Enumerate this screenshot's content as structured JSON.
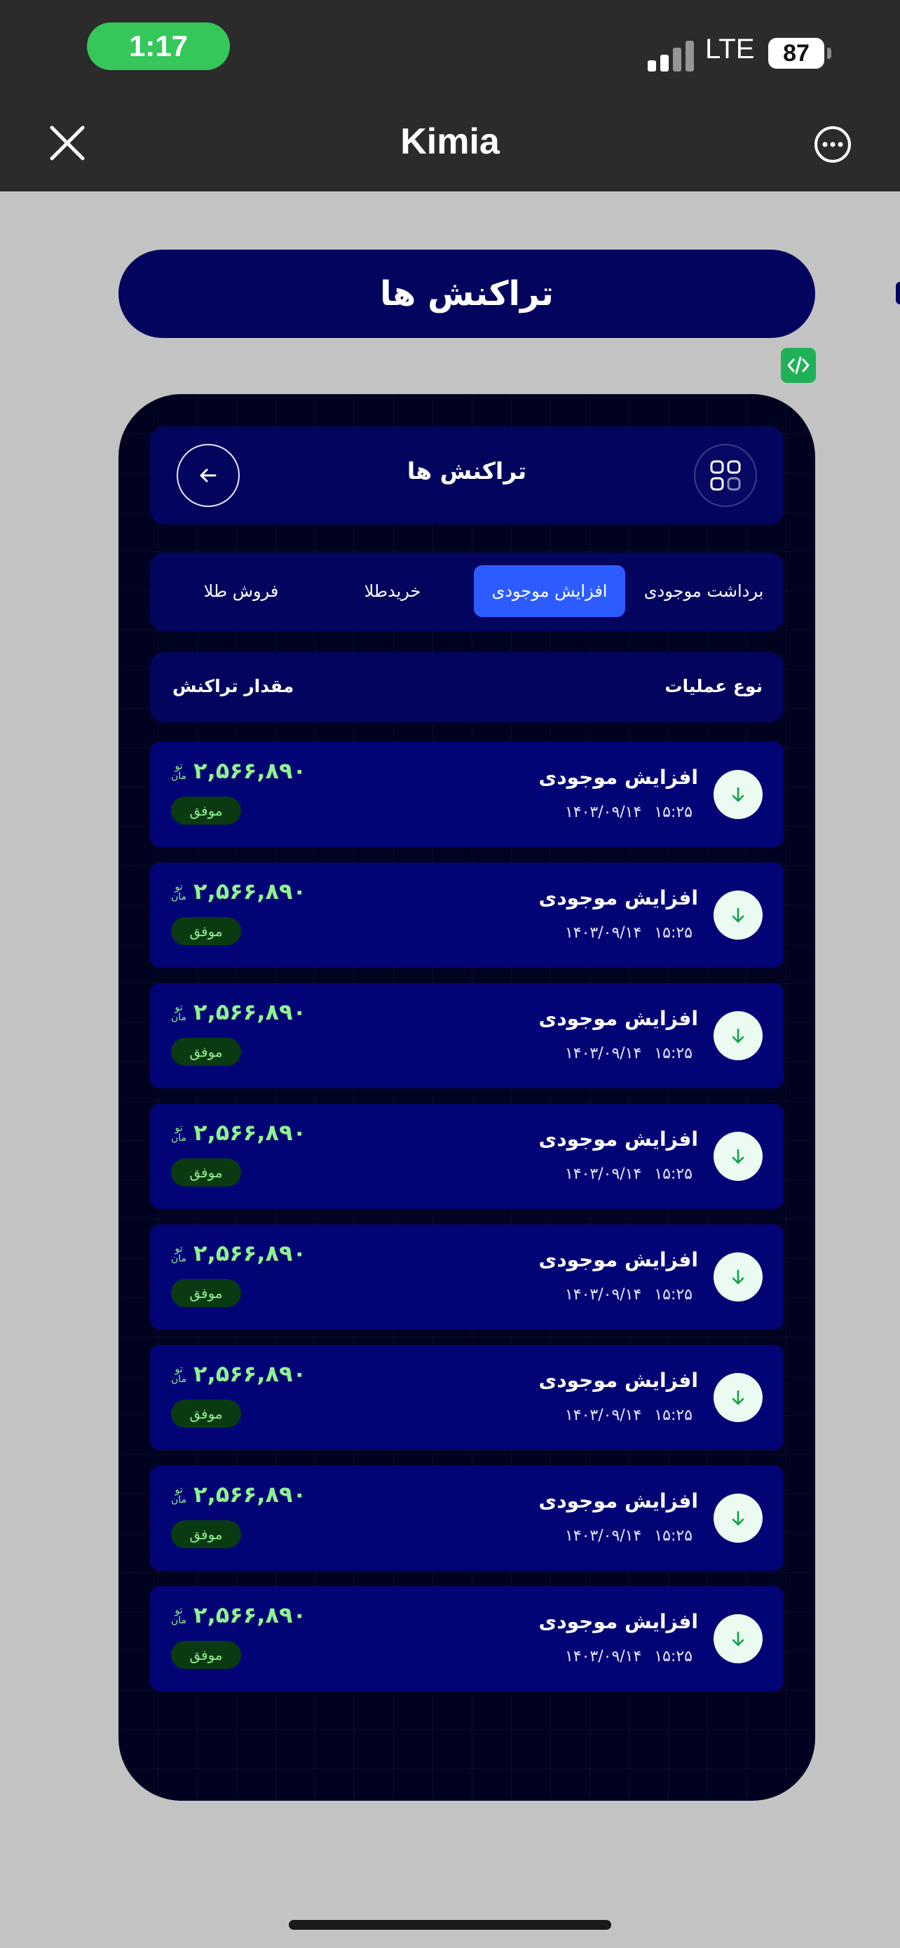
{
  "status_bar": {
    "time": "1:17",
    "network": "LTE",
    "battery": "87"
  },
  "app_bar": {
    "title": "Kimia",
    "close_icon": "close-icon",
    "more_icon": "more-horizontal-icon"
  },
  "page_header": {
    "title": "تراکنش ها"
  },
  "phone": {
    "title": "تراکنش ها",
    "back_icon": "arrow-left-icon",
    "menu_icon": "grid-apps-icon",
    "tabs": [
      {
        "label": "برداشت موجودی",
        "active": false
      },
      {
        "label": "افزایش موجودی",
        "active": true
      },
      {
        "label": "خریدطلا",
        "active": false
      },
      {
        "label": "فروش طلا",
        "active": false
      }
    ],
    "columns": {
      "type": "نوع عملیات",
      "amount": "مقدار تراکنش"
    },
    "transactions": [
      {
        "title": "افزایش موجودی",
        "time": "۱۵:۲۵",
        "date": "۱۴۰۳/۰۹/۱۴",
        "amount": "۲,۵۶۶,۸۹۰",
        "currency_top": "تو",
        "currency_bottom": "مان",
        "status": "موفق",
        "icon": "arrow-down-icon"
      },
      {
        "title": "افزایش موجودی",
        "time": "۱۵:۲۵",
        "date": "۱۴۰۳/۰۹/۱۴",
        "amount": "۲,۵۶۶,۸۹۰",
        "currency_top": "تو",
        "currency_bottom": "مان",
        "status": "موفق",
        "icon": "arrow-down-icon"
      },
      {
        "title": "افزایش موجودی",
        "time": "۱۵:۲۵",
        "date": "۱۴۰۳/۰۹/۱۴",
        "amount": "۲,۵۶۶,۸۹۰",
        "currency_top": "تو",
        "currency_bottom": "مان",
        "status": "موفق",
        "icon": "arrow-down-icon"
      },
      {
        "title": "افزایش موجودی",
        "time": "۱۵:۲۵",
        "date": "۱۴۰۳/۰۹/۱۴",
        "amount": "۲,۵۶۶,۸۹۰",
        "currency_top": "تو",
        "currency_bottom": "مان",
        "status": "موفق",
        "icon": "arrow-down-icon"
      },
      {
        "title": "افزایش موجودی",
        "time": "۱۵:۲۵",
        "date": "۱۴۰۳/۰۹/۱۴",
        "amount": "۲,۵۶۶,۸۹۰",
        "currency_top": "تو",
        "currency_bottom": "مان",
        "status": "موفق",
        "icon": "arrow-down-icon"
      },
      {
        "title": "افزایش موجودی",
        "time": "۱۵:۲۵",
        "date": "۱۴۰۳/۰۹/۱۴",
        "amount": "۲,۵۶۶,۸۹۰",
        "currency_top": "تو",
        "currency_bottom": "مان",
        "status": "موفق",
        "icon": "arrow-down-icon"
      },
      {
        "title": "افزایش موجودی",
        "time": "۱۵:۲۵",
        "date": "۱۴۰۳/۰۹/۱۴",
        "amount": "۲,۵۶۶,۸۹۰",
        "currency_top": "تو",
        "currency_bottom": "مان",
        "status": "موفق",
        "icon": "arrow-down-icon"
      },
      {
        "title": "افزایش موجودی",
        "time": "۱۵:۲۵",
        "date": "۱۴۰۳/۰۹/۱۴",
        "amount": "۲,۵۶۶,۸۹۰",
        "currency_top": "تو",
        "currency_bottom": "مان",
        "status": "موفق",
        "icon": "arrow-down-icon"
      }
    ]
  },
  "colors": {
    "navy": "#03045e",
    "row": "#020475",
    "frame": "#010220",
    "accent": "#2c5cff",
    "success": "#8ff28f",
    "badge": "#1fb157"
  }
}
